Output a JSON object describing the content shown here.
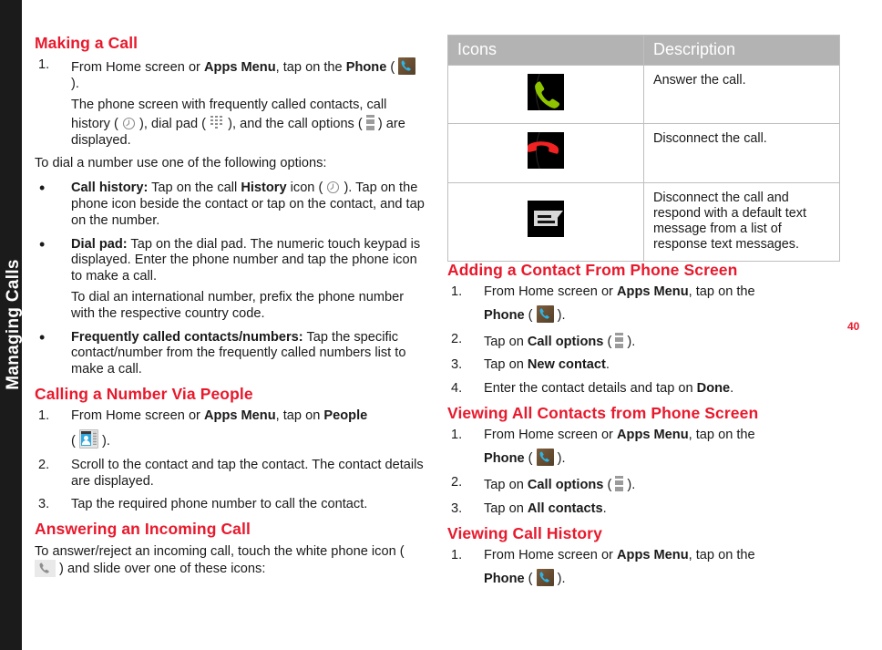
{
  "side_tab": {
    "label": "Managing Calls"
  },
  "page_number": "40",
  "colors": {
    "heading_red": "#e8192c",
    "table_header_bg": "#b3b3b3",
    "side_tab_bg": "#1b1b1b"
  },
  "left_column": {
    "section_making_a_call": {
      "heading": "Making a Call",
      "step1_pre": "From Home screen or ",
      "step1_bold1": "Apps Menu",
      "step1_mid": ", tap on the ",
      "step1_bold2": "Phone",
      "step1_open": " ( ",
      "step1_close": " ).",
      "step1_sub_a": "The phone screen with frequently called contacts, call history ( ",
      "step1_sub_b": " ), dial pad ( ",
      "step1_sub_c": " ), and the call options ( ",
      "step1_sub_d": " ) are displayed.",
      "intro": "To dial a number use one of the following options:",
      "bullets": [
        {
          "bold": "Call history:",
          "text_a": " Tap on the call ",
          "bold2": "History",
          "text_b": " icon ( ",
          "text_c": " ). Tap on the phone icon beside the contact or tap on the contact, and tap on the number."
        },
        {
          "bold": "Dial pad:",
          "text_a": " Tap on the dial pad. The numeric touch keypad is displayed. Enter the phone number and tap the phone icon to make a call.",
          "sub": "To dial an international number, prefix the phone number with the respective country code."
        },
        {
          "bold": "Frequently called contacts/numbers:",
          "text_a": " Tap the specific contact/number from the frequently called numbers list to make a call."
        }
      ]
    },
    "section_calling_via_people": {
      "heading": "Calling a Number Via People",
      "steps": [
        {
          "marker": "1.",
          "pre": "From Home screen or ",
          "bold1": "Apps Menu",
          "mid": ", tap on ",
          "bold2": "People",
          "open": " ( ",
          "close": " )."
        },
        {
          "marker": "2.",
          "text": "Scroll to the contact and tap the contact. The contact details are displayed."
        },
        {
          "marker": "3.",
          "text": "Tap the required phone number to call the contact."
        }
      ]
    },
    "section_answering": {
      "heading": "Answering an Incoming Call",
      "text_a": "To answer/reject an incoming call, touch the white phone icon  ( ",
      "text_b": " ) and slide over one of these icons:"
    }
  },
  "right_column": {
    "icons_table": {
      "headers": [
        "Icons",
        "Description"
      ],
      "rows": [
        {
          "icon": "answer-call-icon",
          "description": "Answer the call."
        },
        {
          "icon": "disconnect-call-icon",
          "description": "Disconnect the call."
        },
        {
          "icon": "respond-message-icon",
          "description": "Disconnect the call and respond with a default text message from a list of response text messages."
        }
      ]
    },
    "section_adding_contact": {
      "heading": "Adding a Contact From Phone Screen",
      "steps": [
        {
          "marker": "1.",
          "pre": "From Home screen or ",
          "bold1": "Apps Menu",
          "mid": ", tap on the ",
          "bold2": "Phone",
          "open": " ( ",
          "close": " )."
        },
        {
          "marker": "2.",
          "pre": "Tap on ",
          "bold1": "Call options",
          "open": " ( ",
          "close": " )."
        },
        {
          "marker": "3.",
          "pre": "Tap on ",
          "bold1": "New contact",
          "close": "."
        },
        {
          "marker": "4.",
          "pre": "Enter the contact details and tap on ",
          "bold1": "Done",
          "close": "."
        }
      ]
    },
    "section_viewing_contacts": {
      "heading": "Viewing All Contacts from Phone Screen",
      "steps": [
        {
          "marker": "1.",
          "pre": "From Home screen or ",
          "bold1": "Apps Menu",
          "mid": ", tap on the ",
          "bold2": "Phone",
          "open": " ( ",
          "close": " )."
        },
        {
          "marker": "2.",
          "pre": "Tap on ",
          "bold1": "Call options",
          "open": " ( ",
          "close": " )."
        },
        {
          "marker": "3.",
          "pre": "Tap on ",
          "bold1": "All contacts",
          "close": "."
        }
      ]
    },
    "section_viewing_history": {
      "heading": "Viewing Call History",
      "steps": [
        {
          "marker": "1.",
          "pre": "From Home screen or ",
          "bold1": "Apps Menu",
          "mid": ", tap on the ",
          "bold2": "Phone",
          "open": " ( ",
          "close": " )."
        }
      ]
    }
  }
}
